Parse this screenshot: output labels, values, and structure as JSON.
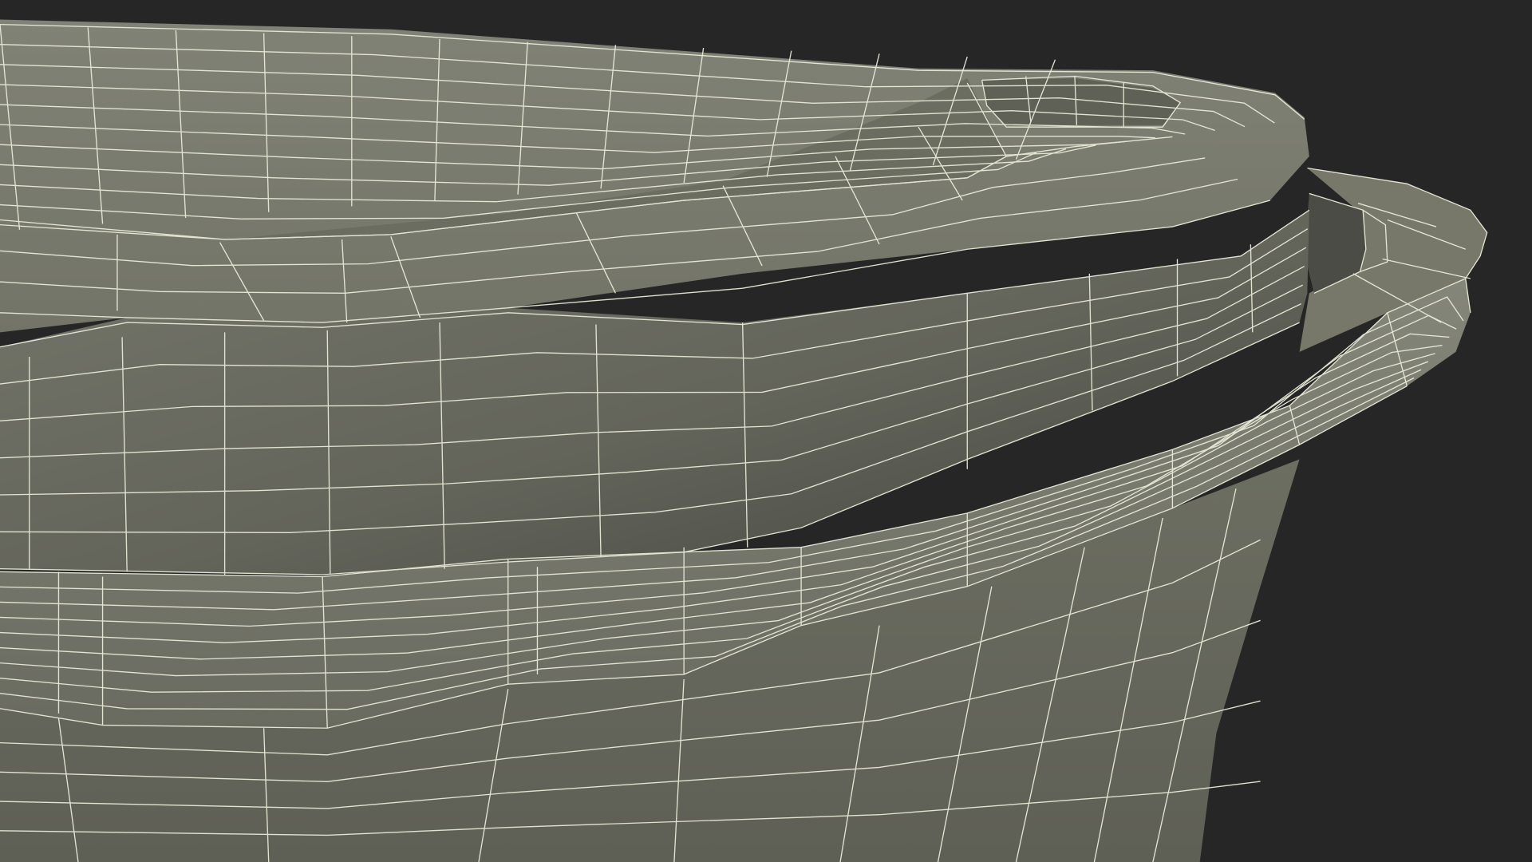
{
  "scene": {
    "subject": "wireframe-mesh-tub",
    "colors": {
      "background": "#262626",
      "surface_light": "#7c7d70",
      "surface_mid": "#6e6f63",
      "surface_dark": "#4d4e46",
      "shadow": "#3c3d37",
      "wire": "#e9ead8"
    }
  }
}
